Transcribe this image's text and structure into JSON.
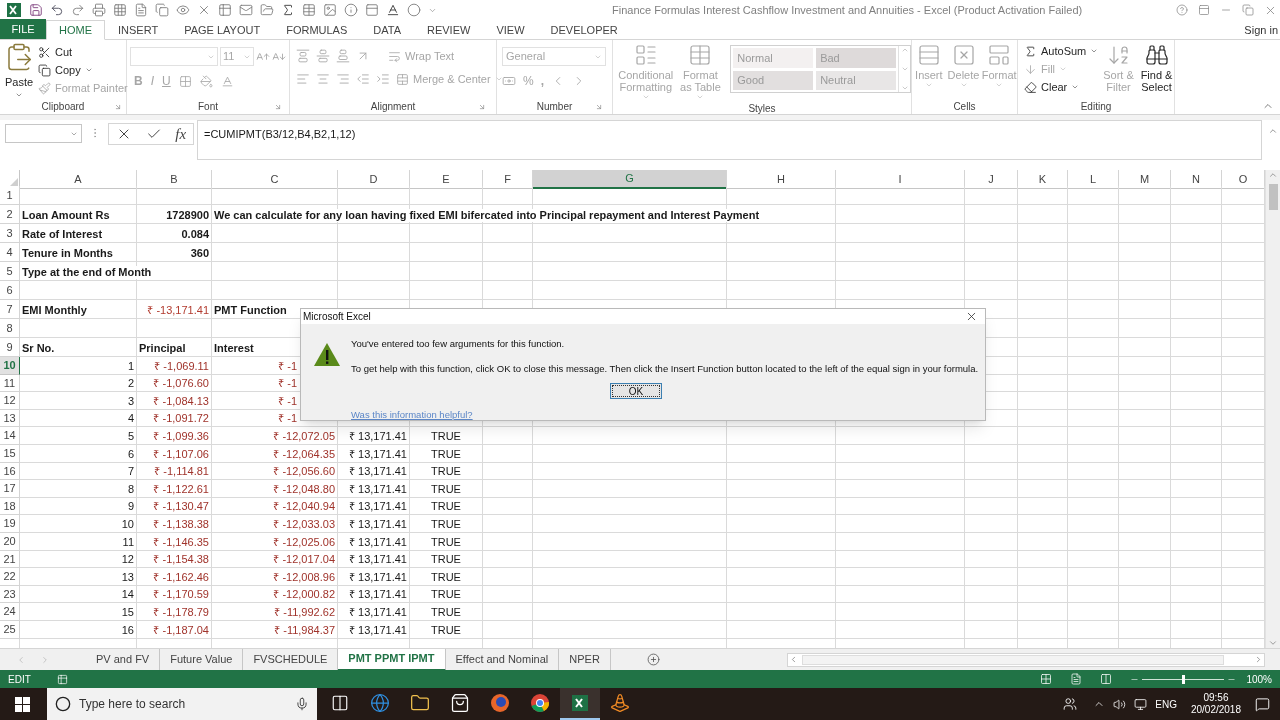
{
  "window": {
    "title": "Finance Formulas Interest Cashflow Investment and Annuities - Excel (Product Activation Failed)",
    "sign_in": "Sign in"
  },
  "ribbon_tabs": [
    {
      "label": "FILE",
      "kind": "file",
      "selected": false
    },
    {
      "label": "HOME",
      "kind": "tab",
      "selected": true
    },
    {
      "label": "INSERT",
      "kind": "tab",
      "selected": false
    },
    {
      "label": "PAGE LAYOUT",
      "kind": "tab",
      "selected": false
    },
    {
      "label": "FORMULAS",
      "kind": "tab",
      "selected": false
    },
    {
      "label": "DATA",
      "kind": "tab",
      "selected": false
    },
    {
      "label": "REVIEW",
      "kind": "tab",
      "selected": false
    },
    {
      "label": "VIEW",
      "kind": "tab",
      "selected": false
    },
    {
      "label": "DEVELOPER",
      "kind": "tab",
      "selected": false
    }
  ],
  "ribbon": {
    "groups": [
      {
        "kind": "clipboard",
        "label": "Clipboard",
        "buttons": [
          {
            "label": "Paste",
            "disabled": false
          },
          {
            "label": "Cut",
            "disabled": false
          },
          {
            "label": "Copy",
            "disabled": false
          },
          {
            "label": "Format Painter",
            "disabled": true
          }
        ]
      },
      {
        "kind": "font",
        "label": "Font",
        "size": "11",
        "buttons": [
          {
            "label": "B",
            "disabled": true
          },
          {
            "label": "I",
            "disabled": true
          },
          {
            "label": "U",
            "disabled": true
          }
        ]
      },
      {
        "kind": "alignment",
        "label": "Alignment",
        "buttons": [
          {
            "label": "Wrap Text",
            "disabled": true
          },
          {
            "label": "Merge & Center",
            "disabled": true
          }
        ]
      },
      {
        "kind": "number",
        "label": "Number",
        "format": "General",
        "buttons": [
          {
            "label": "%",
            "disabled": true
          },
          {
            "label": ",",
            "disabled": true
          }
        ]
      },
      {
        "kind": "styles",
        "label": "Styles",
        "buttons": [
          {
            "label": "Conditional Formatting",
            "disabled": true
          },
          {
            "label": "Format as Table",
            "disabled": true
          }
        ],
        "gallery": [
          {
            "label": "Normal",
            "color": "#f3f0f0"
          },
          {
            "label": "Bad",
            "color": "#dedada"
          },
          {
            "label": "Good",
            "color": "#e2dfdf"
          },
          {
            "label": "Neutral",
            "color": "#e8e6e6"
          }
        ]
      },
      {
        "kind": "cells",
        "label": "Cells",
        "buttons": [
          {
            "label": "Insert",
            "disabled": true
          },
          {
            "label": "Delete",
            "disabled": true
          },
          {
            "label": "Format",
            "disabled": true
          }
        ]
      },
      {
        "kind": "editing",
        "label": "Editing",
        "buttons": [
          {
            "label": "AutoSum",
            "disabled": false
          },
          {
            "label": "Fill",
            "disabled": true
          },
          {
            "label": "Clear",
            "disabled": false
          },
          {
            "label": "Sort & Filter",
            "disabled": true
          },
          {
            "label": "Find & Select",
            "disabled": false
          }
        ]
      }
    ]
  },
  "formula_bar": {
    "fx": "fx",
    "formula": "=CUMIPMT(B3/12,B4,B2,1,12)"
  },
  "columns": [
    {
      "label": "A",
      "selected": false
    },
    {
      "label": "B",
      "selected": false
    },
    {
      "label": "C",
      "selected": false
    },
    {
      "label": "D",
      "selected": false
    },
    {
      "label": "E",
      "selected": false
    },
    {
      "label": "F",
      "selected": false
    },
    {
      "label": "G",
      "selected": true
    },
    {
      "label": "H",
      "selected": false
    },
    {
      "label": "I",
      "selected": false
    },
    {
      "label": "J",
      "selected": false
    },
    {
      "label": "K",
      "selected": false
    },
    {
      "label": "L",
      "selected": false
    },
    {
      "label": "M",
      "selected": false
    },
    {
      "label": "N",
      "selected": false
    },
    {
      "label": "O",
      "selected": false
    }
  ],
  "rows": [
    {
      "n": "1",
      "kind": "blank",
      "selected": false
    },
    {
      "n": "2",
      "kind": "label",
      "selected": false,
      "a": "Loan Amount Rs",
      "b": "1728900",
      "c": "We can calculate for any loan having fixed EMI bifercated into Principal repayment and Interest Payment"
    },
    {
      "n": "3",
      "kind": "label",
      "selected": false,
      "a": "Rate of Interest",
      "b": "0.084"
    },
    {
      "n": "4",
      "kind": "label",
      "selected": false,
      "a": "Tenure in Months",
      "b": "360"
    },
    {
      "n": "5",
      "kind": "label",
      "selected": false,
      "a": "Type at the end of Month"
    },
    {
      "n": "6",
      "kind": "blank",
      "selected": false
    },
    {
      "n": "7",
      "kind": "emi",
      "selected": false,
      "a": "EMI Monthly",
      "b": "₹ -13,171.41",
      "c": "PMT Function"
    },
    {
      "n": "8",
      "kind": "blank_covered",
      "selected": false
    },
    {
      "n": "9",
      "kind": "heading",
      "selected": false,
      "a": "Sr No.",
      "b": "Principal",
      "c": "Interest"
    },
    {
      "n": "10",
      "kind": "covered",
      "selected": true,
      "a": "1",
      "b": "₹ -1,069.11",
      "c": "₹ -1"
    },
    {
      "n": "11",
      "kind": "covered",
      "selected": false,
      "a": "2",
      "b": "₹ -1,076.60",
      "c": "₹ -1"
    },
    {
      "n": "12",
      "kind": "covered",
      "selected": false,
      "a": "3",
      "b": "₹ -1,084.13",
      "c": "₹ -1"
    },
    {
      "n": "13",
      "kind": "covered",
      "selected": false,
      "a": "4",
      "b": "₹ -1,091.72",
      "c": "₹ -1"
    },
    {
      "n": "14",
      "kind": "schedule",
      "selected": false,
      "a": "5",
      "b": "₹ -1,099.36",
      "c": "₹ -12,072.05",
      "d": "₹ 13,171.41",
      "e": "TRUE"
    },
    {
      "n": "15",
      "kind": "schedule",
      "selected": false,
      "a": "6",
      "b": "₹ -1,107.06",
      "c": "₹ -12,064.35",
      "d": "₹ 13,171.41",
      "e": "TRUE"
    },
    {
      "n": "16",
      "kind": "schedule",
      "selected": false,
      "a": "7",
      "b": "₹ -1,114.81",
      "c": "₹ -12,056.60",
      "d": "₹ 13,171.41",
      "e": "TRUE"
    },
    {
      "n": "17",
      "kind": "schedule",
      "selected": false,
      "a": "8",
      "b": "₹ -1,122.61",
      "c": "₹ -12,048.80",
      "d": "₹ 13,171.41",
      "e": "TRUE"
    },
    {
      "n": "18",
      "kind": "schedule",
      "selected": false,
      "a": "9",
      "b": "₹ -1,130.47",
      "c": "₹ -12,040.94",
      "d": "₹ 13,171.41",
      "e": "TRUE"
    },
    {
      "n": "19",
      "kind": "schedule",
      "selected": false,
      "a": "10",
      "b": "₹ -1,138.38",
      "c": "₹ -12,033.03",
      "d": "₹ 13,171.41",
      "e": "TRUE"
    },
    {
      "n": "20",
      "kind": "schedule",
      "selected": false,
      "a": "11",
      "b": "₹ -1,146.35",
      "c": "₹ -12,025.06",
      "d": "₹ 13,171.41",
      "e": "TRUE"
    },
    {
      "n": "21",
      "kind": "schedule",
      "selected": false,
      "a": "12",
      "b": "₹ -1,154.38",
      "c": "₹ -12,017.04",
      "d": "₹ 13,171.41",
      "e": "TRUE"
    },
    {
      "n": "22",
      "kind": "schedule",
      "selected": false,
      "a": "13",
      "b": "₹ -1,162.46",
      "c": "₹ -12,008.96",
      "d": "₹ 13,171.41",
      "e": "TRUE"
    },
    {
      "n": "23",
      "kind": "schedule",
      "selected": false,
      "a": "14",
      "b": "₹ -1,170.59",
      "c": "₹ -12,000.82",
      "d": "₹ 13,171.41",
      "e": "TRUE"
    },
    {
      "n": "24",
      "kind": "schedule",
      "selected": false,
      "a": "15",
      "b": "₹ -1,178.79",
      "c": "₹ -11,992.62",
      "d": "₹ 13,171.41",
      "e": "TRUE"
    },
    {
      "n": "25",
      "kind": "schedule",
      "selected": false,
      "a": "16",
      "b": "₹ -1,187.04",
      "c": "₹ -11,984.37",
      "d": "₹ 13,171.41",
      "e": "TRUE"
    }
  ],
  "dialog": {
    "title": "Microsoft Excel",
    "message": "You've entered too few arguments for this function.",
    "detail": "To get help with this function, click OK to close this message. Then click the Insert Function button located to the left of the equal sign in your formula.",
    "ok": "OK",
    "link": "Was this information helpful?"
  },
  "sheet_tabs": [
    {
      "label": "PV and FV",
      "selected": false
    },
    {
      "label": "Future Value",
      "selected": false
    },
    {
      "label": "FVSCHEDULE",
      "selected": false
    },
    {
      "label": "PMT PPMT IPMT",
      "selected": true
    },
    {
      "label": "Effect and Nominal",
      "selected": false
    },
    {
      "label": "NPER",
      "selected": false
    }
  ],
  "status_bar": {
    "mode": "EDIT",
    "zoom": {
      "level": 0.5,
      "reading": "100%"
    }
  },
  "taskbar": {
    "search": {
      "placeholder": "Type here to search"
    },
    "apps": [
      {
        "kind": "task-view",
        "active": false
      },
      {
        "kind": "edge",
        "active": false
      },
      {
        "kind": "explorer",
        "active": false
      },
      {
        "kind": "store",
        "active": false
      },
      {
        "kind": "firefox",
        "active": false
      },
      {
        "kind": "chrome",
        "active": false
      },
      {
        "kind": "excel",
        "active": true
      },
      {
        "kind": "vlc",
        "active": false
      }
    ],
    "language": "ENG",
    "time": "09:56",
    "date": "20/02/2018"
  }
}
